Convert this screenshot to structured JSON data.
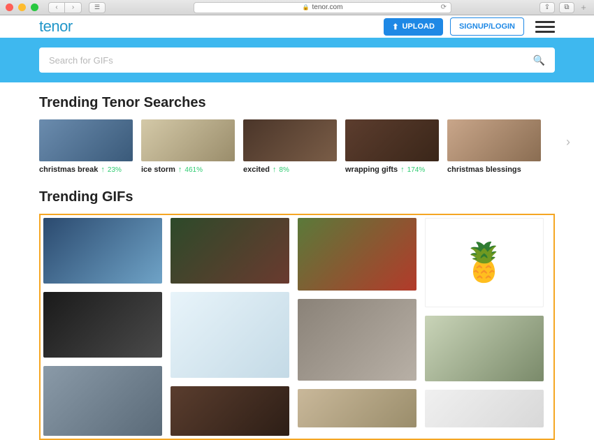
{
  "browser": {
    "url_display": "tenor.com",
    "lock_icon": "lock-icon",
    "back_icon": "chevron-left-icon",
    "forward_icon": "chevron-right-icon",
    "sidebar_icon": "sidebar-icon",
    "share_icon": "share-icon",
    "tabs_icon": "tabs-icon",
    "reload_icon": "reload-icon",
    "addtab_icon": "plus-icon"
  },
  "header": {
    "logo_text": "tenor",
    "upload_label": "UPLOAD",
    "upload_icon": "upload-icon",
    "auth_label": "SIGNUP/LOGIN",
    "menu_icon": "hamburger-icon"
  },
  "search": {
    "placeholder": "Search for GIFs",
    "icon": "search-icon"
  },
  "sections": {
    "trending_searches_title": "Trending Tenor Searches",
    "trending_gifs_title": "Trending GIFs"
  },
  "trending_searches": [
    {
      "label": "christmas break",
      "pct": "23%",
      "thumb_class": "th1"
    },
    {
      "label": "ice storm",
      "pct": "461%",
      "thumb_class": "th2"
    },
    {
      "label": "excited",
      "pct": "8%",
      "thumb_class": "th3"
    },
    {
      "label": "wrapping gifts",
      "pct": "174%",
      "thumb_class": "th4"
    },
    {
      "label": "christmas blessings",
      "pct": "",
      "thumb_class": "th5"
    }
  ],
  "carousel": {
    "next_icon": "chevron-right-icon"
  },
  "gif_columns": [
    [
      {
        "cls": "g-a1"
      },
      {
        "cls": "g-a2"
      },
      {
        "cls": "g-a3"
      }
    ],
    [
      {
        "cls": "g-b1"
      },
      {
        "cls": "g-b2"
      },
      {
        "cls": "g-b3"
      }
    ],
    [
      {
        "cls": "g-c1"
      },
      {
        "cls": "g-c2"
      },
      {
        "cls": "g-c3"
      }
    ],
    [
      {
        "cls": "g-d1",
        "emoji": "🍍"
      },
      {
        "cls": "g-d2"
      },
      {
        "cls": "g-d3"
      }
    ]
  ],
  "colors": {
    "brand_blue": "#3eb8ef",
    "logo_blue": "#2196c9",
    "accent_orange": "#f5a623",
    "trend_green": "#2ecc71"
  }
}
